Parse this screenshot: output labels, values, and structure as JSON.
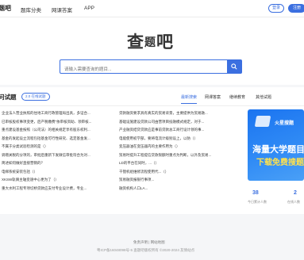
{
  "header": {
    "logo_text": "题吧",
    "nav": [
      "题库分类",
      "网课答案",
      "APP"
    ],
    "login_label": "登录",
    "register_label": "注册"
  },
  "search": {
    "brand_chars": [
      "查",
      "题",
      "吧"
    ],
    "placeholder": "请输入需要查询的题目..."
  },
  "section": {
    "title": "问试题",
    "badge": "2.0 在线试题",
    "tabs": [
      "最新搜索",
      "网课答案",
      "继续教育",
      "其他试题"
    ]
  },
  "questions_left": [
    "企业法人营业执照的住地工商行政管理局出具，多证合...",
    "已审核股权事项变更，后产税缴费\"依审核资助、领审核...",
    "重点建设基金按照（公司法）的相关规定享有股东权利...",
    "基金的发起设立流程包括基金可行性研究、选定基金发...",
    "不属于分类试验检测的是（）",
    "调增关税的分项的，审批后重新下发微信审批符合为对...",
    "简述如何做好直接营销的？",
    "电梯系统安装包括（）",
    "XKSW轨俩主轴变速中心更为了（）",
    "重大水利工程专项切桥贷款应支付专业设计费，专业..."
  ],
  "questions_right": [
    "贷款融资要求具有真实的贸易背景，主要提供为贸易融...",
    "基础设施建设贷款公司由营项目投融模式规定，对于...",
    "产业融资结贷贷款应是事前贷款总工商行设计领的事...",
    "电能使用初学部，要将电流计级别设上，以防（）",
    "变压器油在变压器内的主要作用为（）",
    "贸易时提升工程提信贷款限额时重点为判断，以外及贸易...",
    "LD的平台在同时，...（）",
    "干锂机组维修流程使用代...（）",
    "贸易融资报银行事项...",
    "融资机构人口LA..."
  ],
  "ad": {
    "brand": "火星搜题",
    "line1": "海量大学题目",
    "line2": "下载免费搜题"
  },
  "stats": [
    {
      "value": "38",
      "label": "今日累计人数"
    },
    {
      "value": "2",
      "label": "在线人数"
    }
  ],
  "footer": {
    "links": "免责声明 | 网站地图",
    "copyright": "粤ICP备16048098号-5 查题吧版权所有 ©2020-2024 友情站点"
  },
  "colors": {
    "accent": "#3b6fe0",
    "ad_highlight": "#ffe14d"
  }
}
